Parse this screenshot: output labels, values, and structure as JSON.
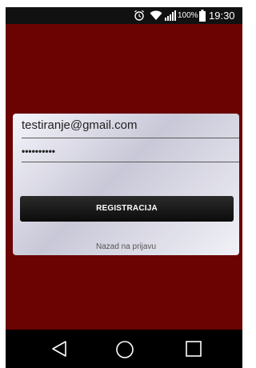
{
  "status_bar": {
    "icons": [
      "alarm-icon",
      "wifi-icon",
      "signal-icon",
      "battery-icon"
    ],
    "battery_level": "100%",
    "time": "19:30"
  },
  "form": {
    "email_value": "testiranje@gmail.com",
    "password_value": "••••••••••",
    "register_label": "REGISTRACIJA",
    "back_link_label": "Nazad na prijavu"
  },
  "nav_bar": {
    "icons": [
      "back-icon",
      "home-icon",
      "recents-icon"
    ]
  },
  "colors": {
    "background": "#6b0303",
    "button": "#111111",
    "card": "#e4e4ee"
  }
}
